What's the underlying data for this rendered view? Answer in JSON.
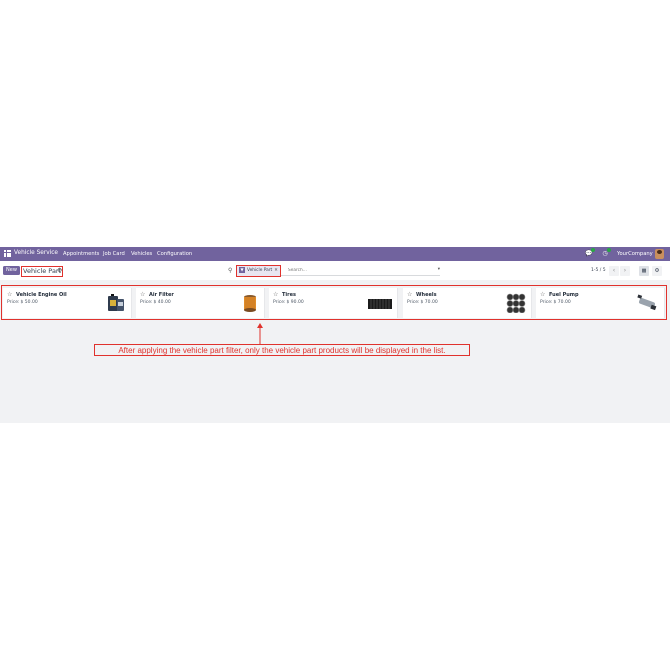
{
  "navbar": {
    "app_name": "Vehicle Service",
    "menu": [
      "Appointments",
      "Job Card",
      "Vehicles",
      "Configuration"
    ],
    "company": "YourCompany"
  },
  "control_panel": {
    "new_label": "New",
    "title": "Vehicle Part",
    "facet_label": "Vehicle Part",
    "search_placeholder": "Search...",
    "pager": "1-5 / 5"
  },
  "cards": [
    {
      "name": "Vehicle Engine Oil",
      "price_label": "Price:",
      "price": "$ 50.00",
      "image": "engine-oil-icon"
    },
    {
      "name": "Air Filter",
      "price_label": "Price:",
      "price": "$ 40.00",
      "image": "air-filter-icon"
    },
    {
      "name": "Tires",
      "price_label": "Price:",
      "price": "$ 90.00",
      "image": "tires-icon"
    },
    {
      "name": "Wheels",
      "price_label": "Price:",
      "price": "$ 70.00",
      "image": "wheels-icon"
    },
    {
      "name": "Fuel Pump",
      "price_label": "Price:",
      "price": "$ 70.00",
      "image": "fuel-pump-icon"
    }
  ],
  "annotation": "After applying the vehicle part filter, only the vehicle part products will be displayed in the list.",
  "colors": {
    "brand": "#71639e",
    "annotation": "#e0322d",
    "notification": "#28a745"
  }
}
